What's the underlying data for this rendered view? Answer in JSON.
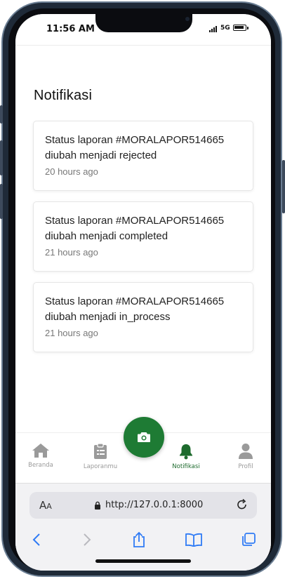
{
  "status_bar": {
    "time": "11:56 AM",
    "network": "5G"
  },
  "page": {
    "title": "Notifikasi"
  },
  "notifications": [
    {
      "message": "Status laporan #MORALAPOR514665 diubah menjadi rejected",
      "time": "20 hours ago"
    },
    {
      "message": "Status laporan #MORALAPOR514665 diubah menjadi completed",
      "time": "21 hours ago"
    },
    {
      "message": "Status laporan #MORALAPOR514665 diubah menjadi in_process",
      "time": "21 hours ago"
    }
  ],
  "bottom_nav": {
    "items": [
      {
        "label": "Beranda",
        "icon": "home-icon",
        "active": false
      },
      {
        "label": "Laporanmu",
        "icon": "clipboard-icon",
        "active": false
      },
      {
        "label": "Notifikasi",
        "icon": "bell-icon",
        "active": true
      },
      {
        "label": "Profil",
        "icon": "user-icon",
        "active": false
      }
    ],
    "fab_icon": "camera-icon",
    "accent_color": "#1e7b34",
    "inactive_color": "#9a9a9a"
  },
  "browser": {
    "text_size_label_big": "A",
    "text_size_label_small": "A",
    "url": "http://127.0.0.1:8000",
    "icons": [
      "lock-icon",
      "reload-icon",
      "back-icon",
      "forward-icon",
      "share-icon",
      "bookmarks-icon",
      "tabs-icon"
    ]
  }
}
